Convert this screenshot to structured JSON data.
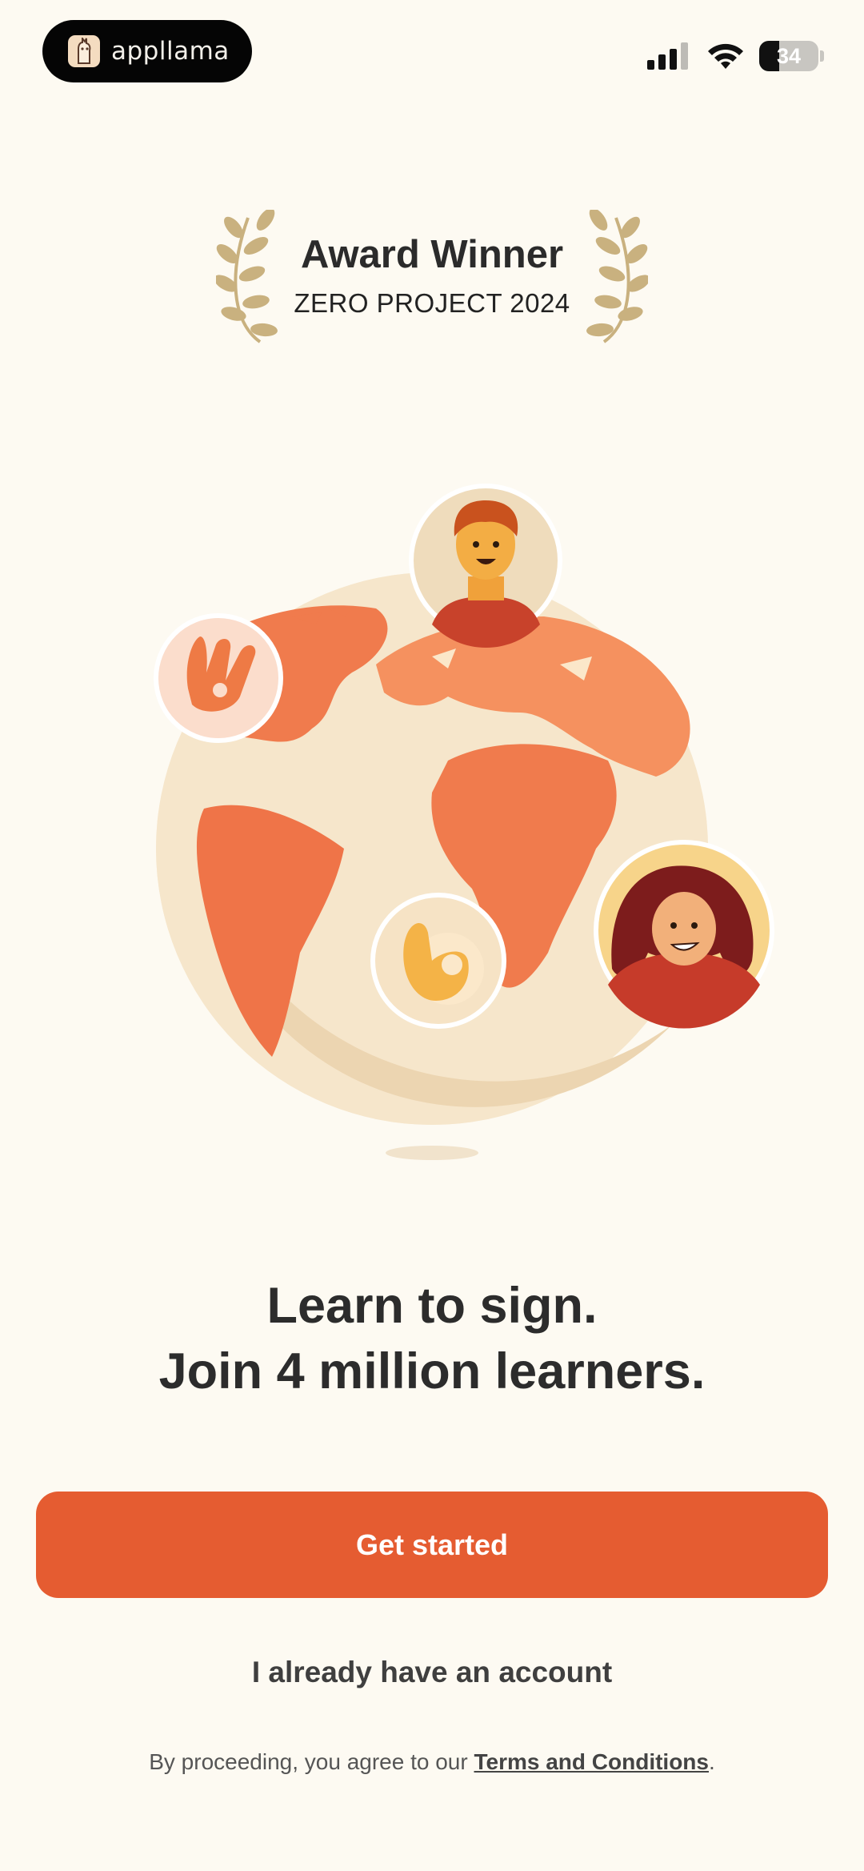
{
  "app": {
    "brand_name": "appllama"
  },
  "status_bar": {
    "battery_level": "34",
    "battery_percent": 34
  },
  "award": {
    "title": "Award Winner",
    "subtitle": "ZERO PROJECT 2024"
  },
  "hero": {
    "line1": "Learn to sign.",
    "line2": "Join 4 million learners."
  },
  "actions": {
    "get_started": "Get started",
    "have_account": "I already have an account"
  },
  "legal": {
    "prefix": "By proceeding, you agree to our",
    "terms_link": "Terms and Conditions",
    "suffix": "."
  },
  "colors": {
    "background": "#fdfaf2",
    "accent": "#e55c31",
    "globe_land": "#f07b4d",
    "globe_sea": "#f6e4c6",
    "laurel": "#c9b17f"
  },
  "icons": [
    "llama-icon",
    "signal-icon",
    "wifi-icon",
    "battery-icon",
    "laurel-icon"
  ]
}
